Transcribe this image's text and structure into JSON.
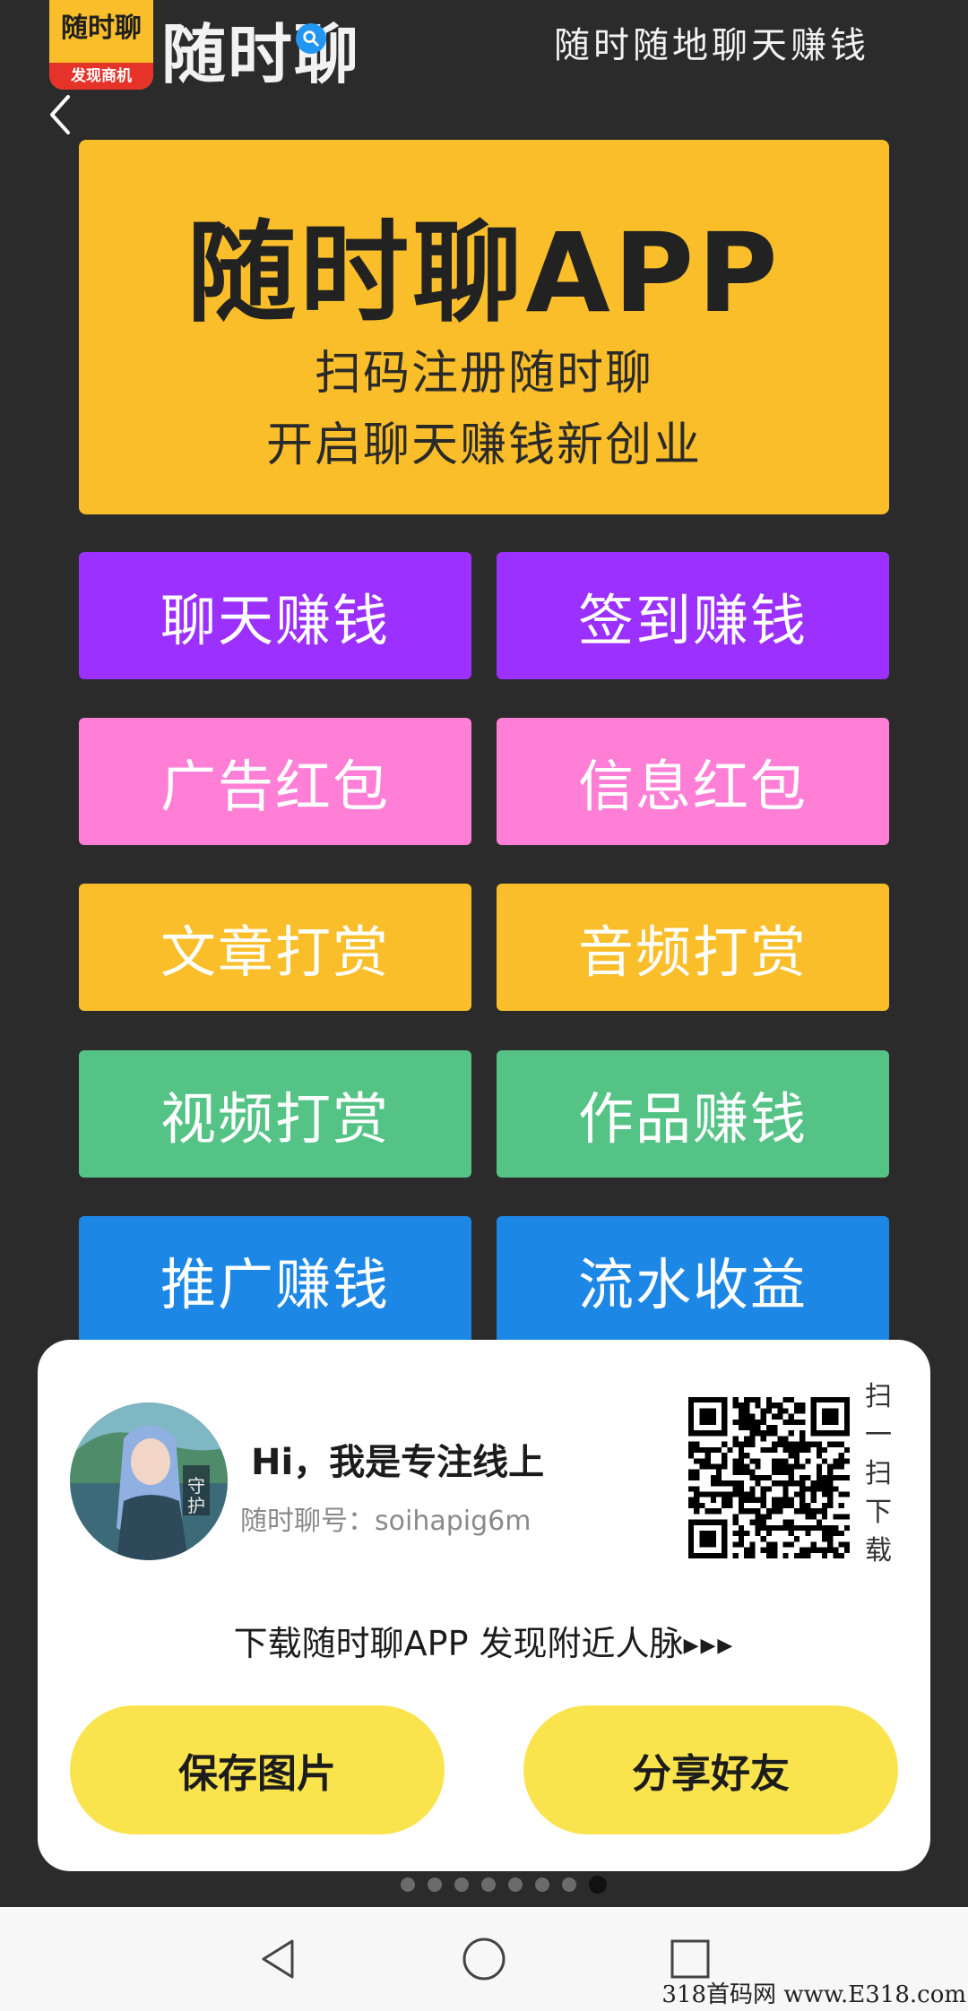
{
  "header": {
    "logo_top": "随时聊",
    "logo_bottom": "发现商机",
    "brand": "随时聊",
    "slogan": "随时随地聊天赚钱"
  },
  "banner": {
    "title": "随时聊APP",
    "line1": "扫码注册随时聊",
    "line2": "开启聊天赚钱新创业"
  },
  "features": [
    {
      "label": "聊天赚钱"
    },
    {
      "label": "签到赚钱"
    },
    {
      "label": "广告红包"
    },
    {
      "label": "信息红包"
    },
    {
      "label": "文章打赏"
    },
    {
      "label": "音频打赏"
    },
    {
      "label": "视频打赏"
    },
    {
      "label": "作品赚钱"
    },
    {
      "label": "推广赚钱"
    },
    {
      "label": "流水收益"
    }
  ],
  "card": {
    "greeting": "Hi，我是专注线上",
    "user_id_label": "随时聊号：",
    "user_id": "soihapig6m",
    "scan_text": [
      "扫",
      "一",
      "扫",
      "下",
      "载"
    ],
    "promo_text": "下载随时聊APP 发现附近人脉",
    "promo_arrows": "▶▶▶",
    "save_label": "保存图片",
    "share_label": "分享好友"
  },
  "pager": {
    "total": 8,
    "active_index": 7
  },
  "watermark": "318首码网 www.E318.com",
  "colors": {
    "background": "#2b2b2b",
    "yellow": "#f9be29",
    "purple": "#9b30ff",
    "pink": "#ff7fd6",
    "green": "#55c386",
    "blue": "#1d87e6",
    "button_yellow": "#fae44e"
  },
  "icons": {
    "back": "chevron-left-icon",
    "search": "search-icon",
    "nav_back": "triangle-back-icon",
    "nav_home": "circle-home-icon",
    "nav_recent": "square-recent-icon"
  }
}
